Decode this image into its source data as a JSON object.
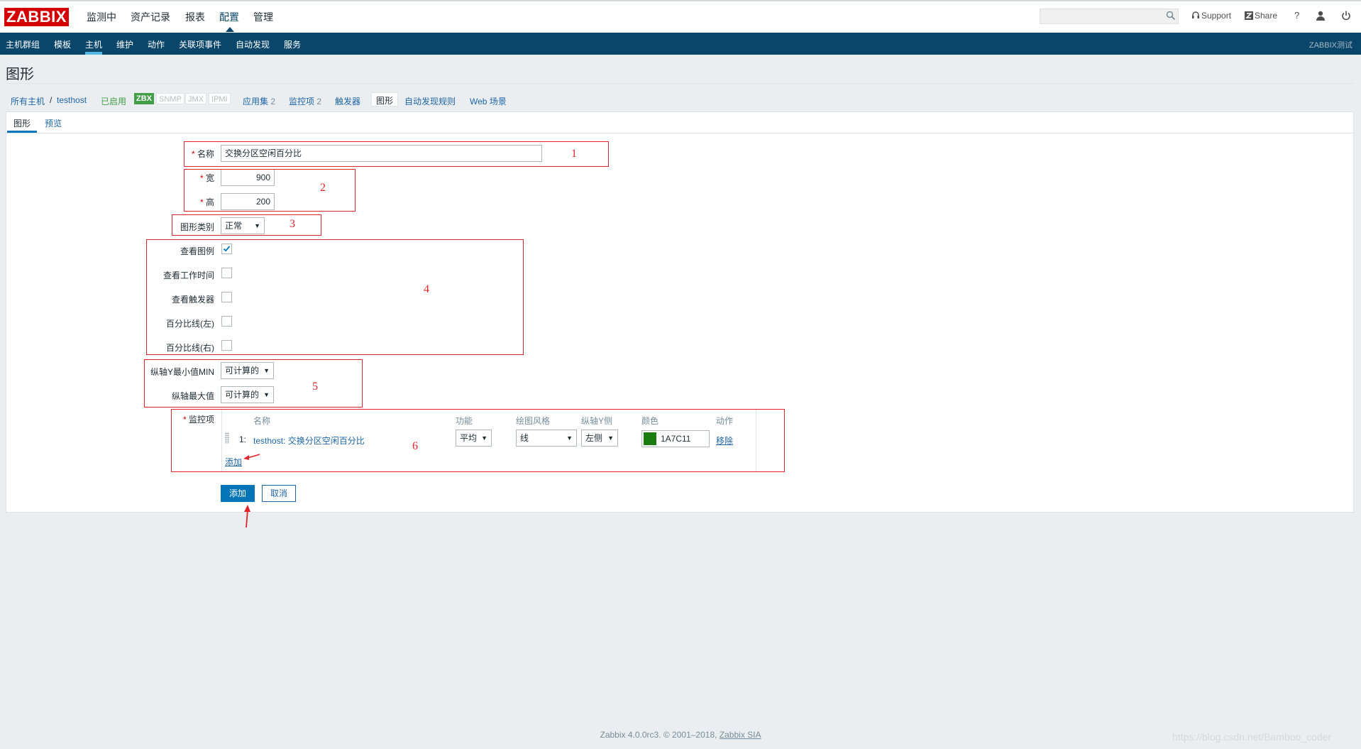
{
  "header": {
    "logo": "ZABBIX",
    "nav": [
      "监测中",
      "资产记录",
      "报表",
      "配置",
      "管理"
    ],
    "support": "Support",
    "share": "Share",
    "help": "?"
  },
  "subnav": {
    "items": [
      "主机群组",
      "模板",
      "主机",
      "维护",
      "动作",
      "关联项事件",
      "自动发现",
      "服务"
    ],
    "right_text": "ZABBIX测试"
  },
  "page": {
    "title": "图形"
  },
  "breadcrumb": {
    "all_hosts": "所有主机",
    "sep": "/",
    "host": "testhost",
    "enabled": "已启用",
    "tags": [
      "ZBX",
      "SNMP",
      "JMX",
      "IPMI"
    ],
    "apps": "应用集",
    "apps_count": "2",
    "items": "监控项",
    "items_count": "2",
    "triggers": "触发器",
    "graphs": "图形",
    "discovery": "自动发现规则",
    "web": "Web 场景"
  },
  "tabs": {
    "graph": "图形",
    "preview": "预览"
  },
  "form": {
    "name_label": "名称",
    "name_value": "交换分区空闲百分比",
    "width_label": "宽",
    "width_value": "900",
    "height_label": "高",
    "height_value": "200",
    "type_label": "图形类别",
    "type_value": "正常",
    "legend_label": "查看图例",
    "worktime_label": "查看工作时间",
    "triggers_label": "查看触发器",
    "pct_left_label": "百分比线(左)",
    "pct_right_label": "百分比线(右)",
    "ymin_label": "纵轴Y最小值MIN",
    "ymin_value": "可计算的",
    "ymax_label": "纵轴最大值",
    "ymax_value": "可计算的",
    "items_label": "监控项",
    "items_headers": [
      "名称",
      "功能",
      "绘图风格",
      "纵轴Y侧",
      "颜色",
      "动作"
    ],
    "item_row": {
      "index": "1:",
      "name": "testhost: 交换分区空闲百分比",
      "function": "平均",
      "style": "线",
      "side": "左侧",
      "color_value": "1A7C11",
      "remove": "移除"
    },
    "add_link": "添加",
    "add_button": "添加",
    "cancel_button": "取消"
  },
  "annotations": [
    "1",
    "2",
    "3",
    "4",
    "5",
    "6"
  ],
  "colors": {
    "item_color": "#1A7C11",
    "brand": "#d40000",
    "nav": "#0a466a"
  },
  "footer": {
    "text": "Zabbix 4.0.0rc3. © 2001–2018,",
    "company": "Zabbix SIA"
  },
  "watermark": "https://blog.csdn.net/Bamboo_coder"
}
